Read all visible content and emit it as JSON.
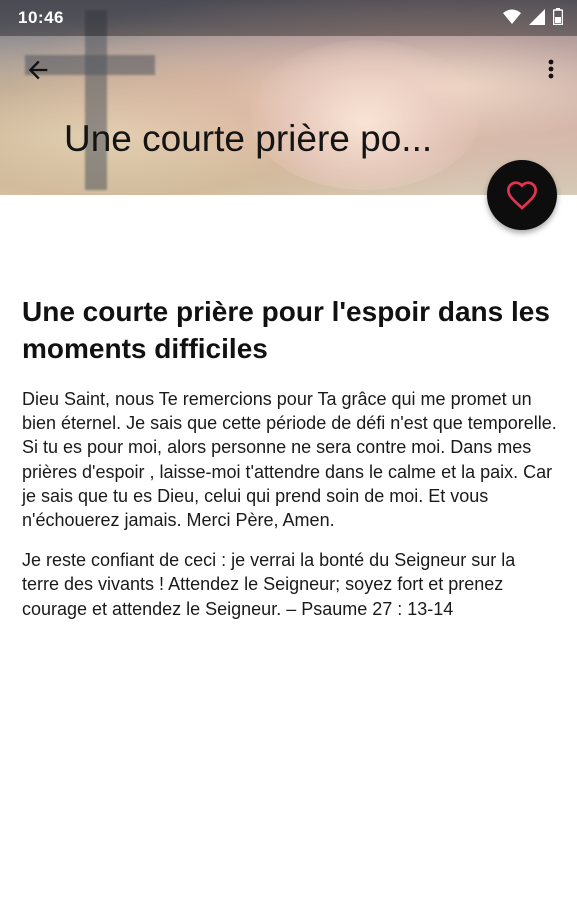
{
  "status_bar": {
    "time": "10:46"
  },
  "header": {
    "title": "Une courte prière po..."
  },
  "article": {
    "title": "Une courte prière pour l'espoir dans les moments difficiles",
    "paragraphs": [
      "Dieu Saint, nous Te remercions pour Ta grâce qui me promet un bien éternel. Je sais que cette période de défi n'est que temporelle. Si tu es pour moi, alors personne ne sera contre moi. Dans mes prières d'espoir , laisse-moi t'attendre dans le calme et la paix. Car je sais que tu es Dieu, celui qui prend soin de moi. Et vous n'échouerez jamais. Merci Père, Amen.",
      "Je reste confiant de ceci : je verrai la bonté du Seigneur sur la terre des vivants ! Attendez le Seigneur; soyez fort et prenez courage et attendez le Seigneur. – Psaume 27 : 13-14"
    ]
  },
  "icons": {
    "back": "arrow-back-icon",
    "more": "more-vert-icon",
    "favorite": "heart-outline-icon"
  },
  "colors": {
    "fab_background": "#0d0d0d",
    "heart": "#e0334f"
  }
}
